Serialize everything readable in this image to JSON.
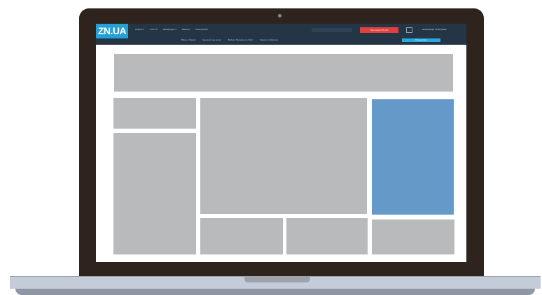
{
  "site": {
    "logo_text": "ZN.UA",
    "nav_main": [
      "Новини ▾",
      "Статті ▾",
      "Міжнародне ▾",
      "Фінанси",
      "Спецпроекти"
    ],
    "red_button_label": "Підтримати ZN.UA",
    "account_label": "Авторизація | Реєстрація",
    "nav_sub": [
      "Війна в Україні",
      "Енергетична криза",
      "Вибори Президента США",
      "Україна та Європа"
    ],
    "subscribe_label": "Передплата"
  },
  "colors": {
    "lid": "#2e241d",
    "header": "#243546",
    "logo_bg": "#24a0d7",
    "red_button": "#e0413f",
    "subscribe_button": "#29a9e0",
    "placeholder_gray": "#b9babc",
    "placeholder_blue": "#6599c8",
    "base": "#c4ccd9"
  },
  "icons": {
    "camera": "camera-dot-icon",
    "language": "language-switch-icon"
  }
}
